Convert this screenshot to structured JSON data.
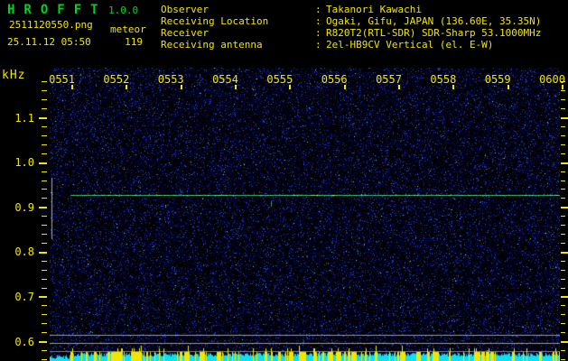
{
  "header": {
    "app_title": "HROFFT",
    "version": "1.0.0",
    "filename": "2511120550.png",
    "mode": "meteor",
    "datetime": "25.11.12 05:50",
    "echo_count": "119",
    "info": [
      {
        "label": "Observer",
        "value": "Takanori Kawachi"
      },
      {
        "label": "Receiving Location",
        "value": "Ogaki, Gifu, JAPAN (136.60E, 35.35N)"
      },
      {
        "label": "Receiver",
        "value": "R820T2(RTL-SDR) SDR-Sharp 53.1000MHz"
      },
      {
        "label": "Receiving antenna",
        "value": "2el-HB9CV Vertical (el. E-W)"
      }
    ]
  },
  "colors": {
    "title_green": "#00d41e",
    "text_yellow": "#f0e600",
    "axis_yellow": "#f0e600",
    "noise_blue": "#2233cc",
    "carrier_green": "#30c468",
    "signal_cyan": "#10dff0",
    "activity_yellow": "#f0e600",
    "reference_gray": "#9a9a9a",
    "background": "#000000"
  },
  "chart_data": {
    "type": "heatmap",
    "subtype": "radio-meteor-echo-spectrogram",
    "title": "HROFFT 1.0.0 meteor 25.11.12 05:50 (2511120550.png), echo count 119",
    "x_axis": {
      "tick_labels": [
        "0551",
        "0552",
        "0553",
        "0554",
        "0555",
        "0556",
        "0557",
        "0558",
        "0559",
        "0600"
      ],
      "description": "time of day hhmm, one major tick per minute"
    },
    "y_axis": {
      "unit_label": "kHz",
      "tick_labels": [
        "1.1",
        "1.0",
        "0.9",
        "0.8",
        "0.7",
        "0.6"
      ],
      "minor_tick_step_khz": 0.02,
      "range_khz": [
        0.56,
        1.18
      ]
    },
    "background_texture": "dense random dark-blue noise speckle on black",
    "features": {
      "carrier_line": {
        "freq_khz": 0.92,
        "time_span": [
          "0551",
          "0600"
        ],
        "color": "#30c468",
        "description": "continuous narrow green-cyan carrier trace with small brighter blips"
      },
      "detection_band_marker": {
        "freq_range_khz": [
          0.81,
          0.95
        ],
        "position": "left edge vertical gray bar",
        "color": "#9a9a9a"
      },
      "reference_lines_khz": [
        0.61,
        0.6,
        0.58
      ],
      "bottom_bar_strip": {
        "signal_bars_color": "#10dff0",
        "activity_bars_color": "#f0e600",
        "description": "cyan signal-level bars along full width; yellow activity bars begin at 0551 (where carrier starts), ~35% density with occasional taller spikes"
      }
    },
    "noise_params": {
      "dot_density": 0.3,
      "bright_dot_density": 0.045,
      "cyan_speck_density": 0.0012,
      "seed": 42
    }
  }
}
